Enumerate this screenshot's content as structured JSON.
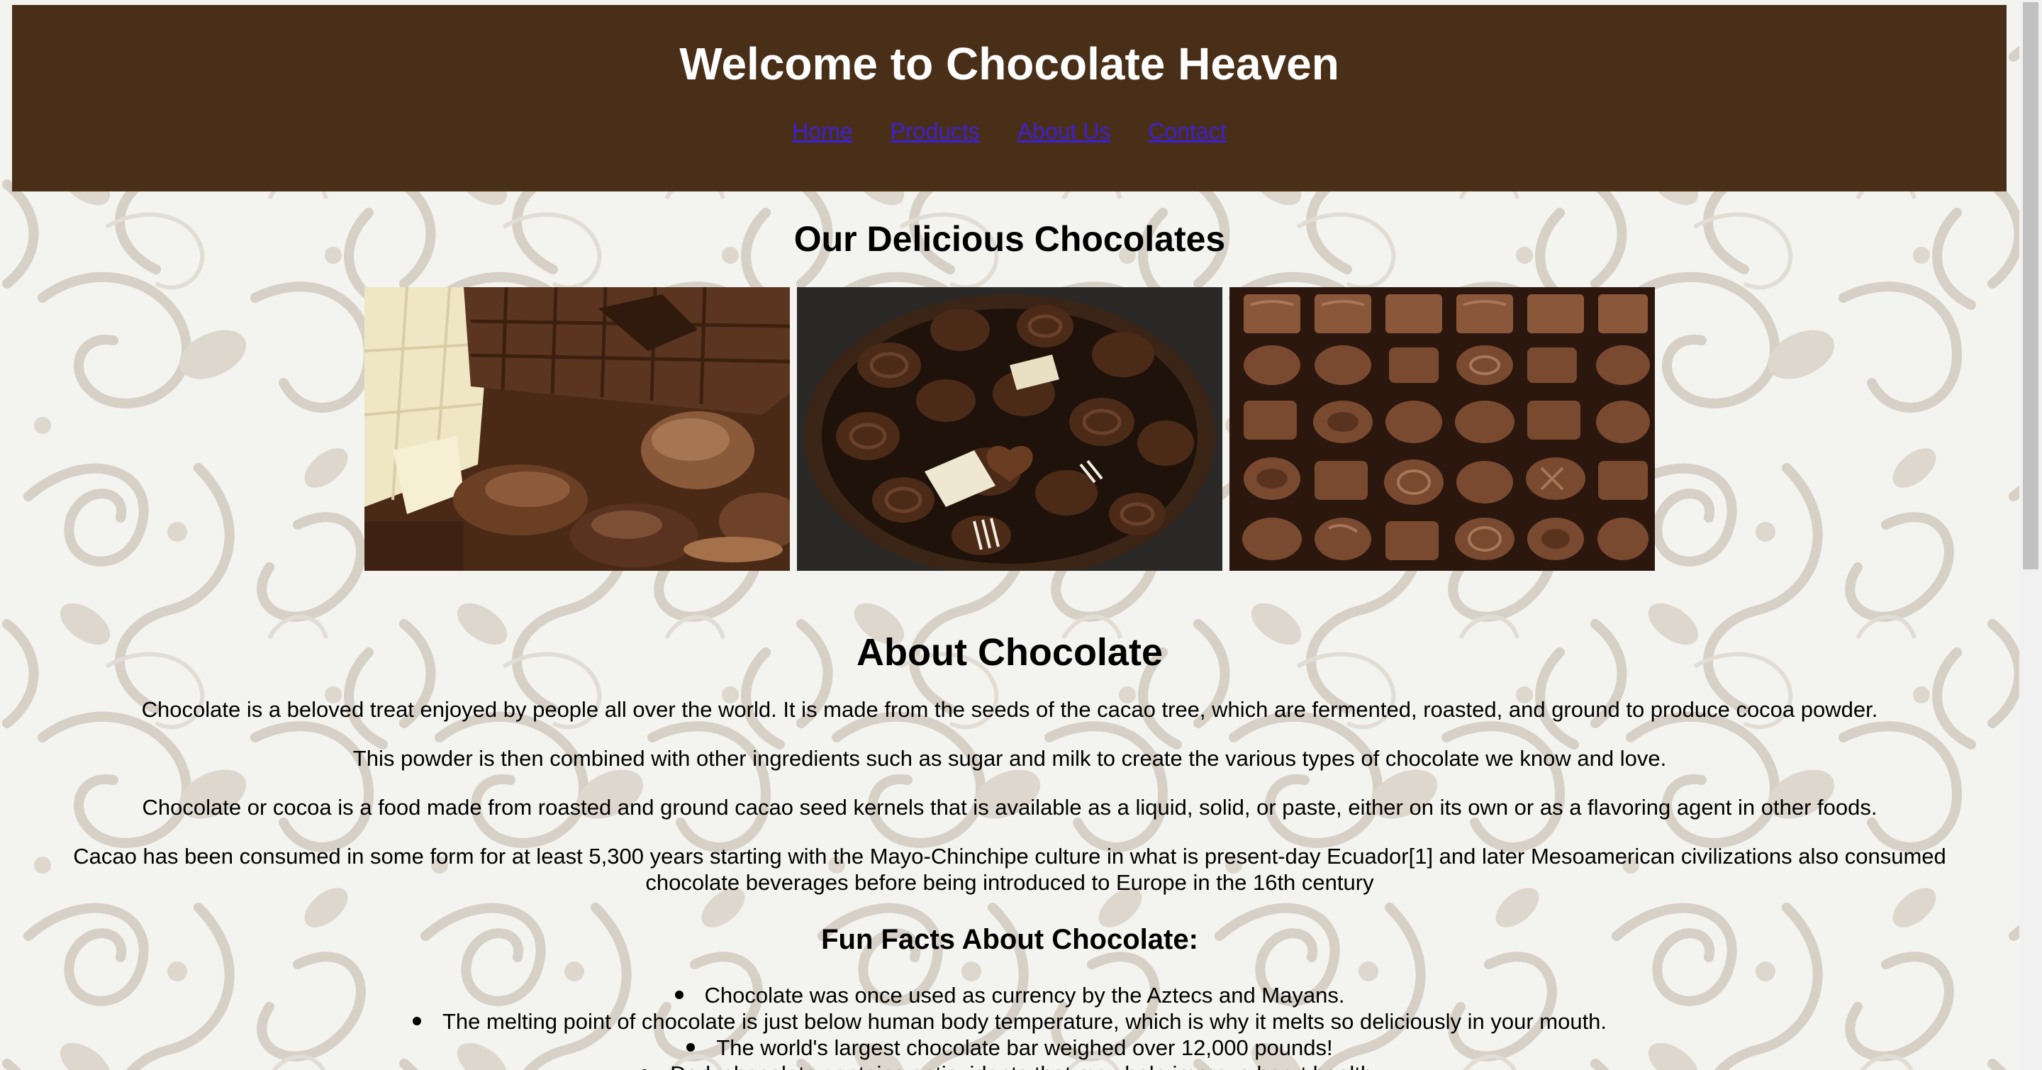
{
  "header": {
    "title": "Welcome to Chocolate Heaven",
    "nav": [
      "Home",
      "Products",
      "About Us",
      "Contact"
    ]
  },
  "products": {
    "title": "Our Delicious Chocolates",
    "images": [
      "chocolate-bars-image",
      "bonbon-bowl-image",
      "chocolate-box-image"
    ]
  },
  "about": {
    "title": "About Chocolate",
    "paragraphs": [
      "Chocolate is a beloved treat enjoyed by people all over the world. It is made from the seeds of the cacao tree, which are fermented, roasted, and ground to produce cocoa powder.",
      "This powder is then combined with other ingredients such as sugar and milk to create the various types of chocolate we know and love.",
      "Chocolate or cocoa is a food made from roasted and ground cacao seed kernels that is available as a liquid, solid, or paste, either on its own or as a flavoring agent in other foods.",
      "Cacao has been consumed in some form for at least 5,300 years starting with the Mayo-Chinchipe culture in what is present-day Ecuador[1] and later Mesoamerican civilizations also consumed chocolate beverages before being introduced to Europe in the 16th century"
    ]
  },
  "facts": {
    "title": "Fun Facts About Chocolate:",
    "items": [
      "Chocolate was once used as currency by the Aztecs and Mayans.",
      "The melting point of chocolate is just below human body temperature, which is why it melts so deliciously in your mouth.",
      "The world's largest chocolate bar weighed over 12,000 pounds!",
      "Dark chocolate contains antioxidants that may help improve heart health."
    ]
  },
  "colors": {
    "header_bg": "#4a2f18",
    "link": "#3d1fd6",
    "page_bg": "#f3f3f0"
  }
}
